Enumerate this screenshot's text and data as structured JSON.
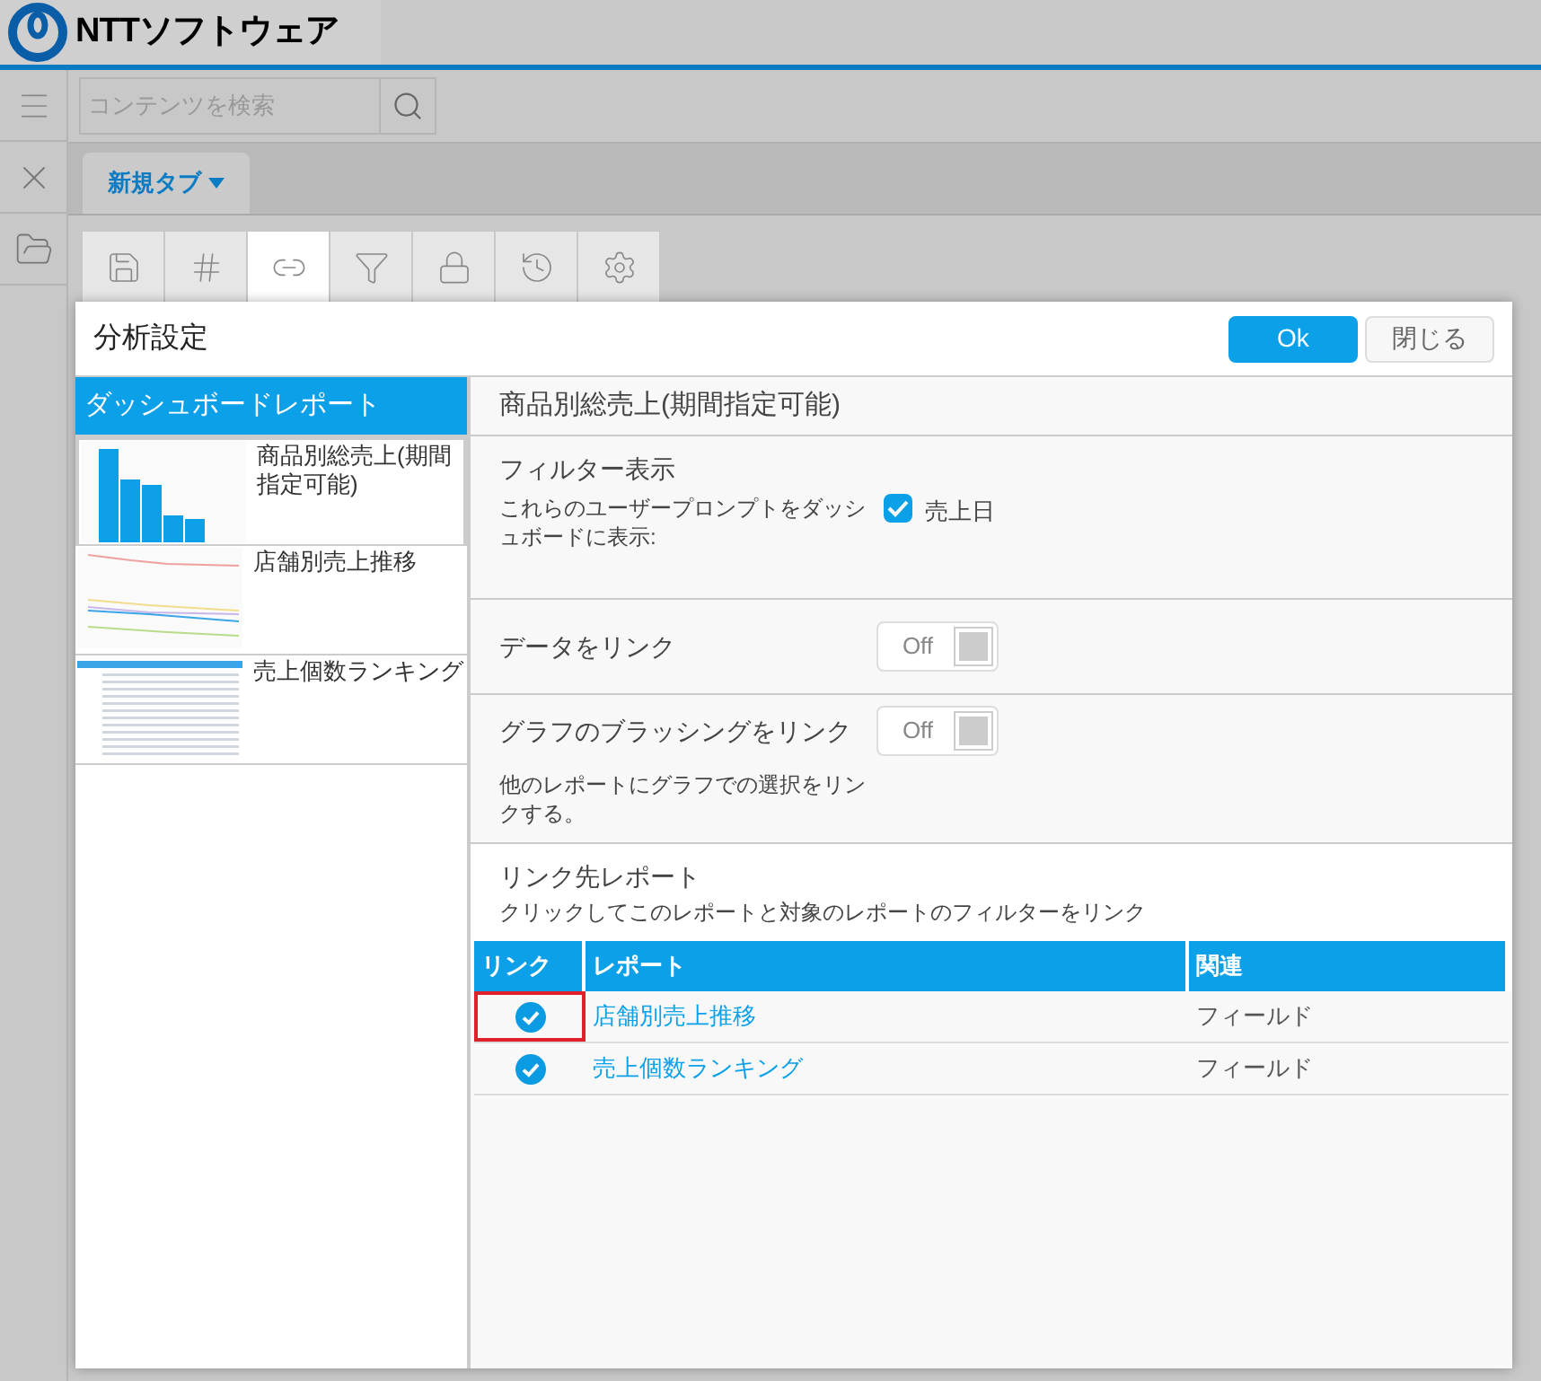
{
  "header": {
    "logo": "NTTソフトウェア"
  },
  "search": {
    "placeholder": "コンテンツを検索"
  },
  "tabs": [
    {
      "label": "新規タブ",
      "selected": true
    }
  ],
  "tools": [
    {
      "kind": "save",
      "selected": false
    },
    {
      "kind": "grid",
      "selected": false
    },
    {
      "kind": "link",
      "selected": true
    },
    {
      "kind": "filter",
      "selected": false
    },
    {
      "kind": "lock",
      "selected": false
    },
    {
      "kind": "history",
      "selected": false
    },
    {
      "kind": "settings",
      "selected": false
    }
  ],
  "dialog": {
    "title": "分析設定",
    "buttons": [
      {
        "label": "Ok",
        "kind": "primary"
      },
      {
        "label": "閉じる",
        "kind": "secondary"
      }
    ],
    "sidebar": {
      "title": "ダッシュボードレポート",
      "items": [
        {
          "title": "商品別総売上(期間指定可能)",
          "kind": "bar",
          "selected": true
        },
        {
          "title": "店舗別売上推移",
          "kind": "line",
          "selected": false
        },
        {
          "title": "売上個数ランキング",
          "kind": "table",
          "selected": false
        }
      ]
    },
    "report_title": "商品別総売上(期間指定可能)",
    "filter": {
      "title": "フィルター表示",
      "description": "これらのユーザープロンプトをダッシュボードに表示:",
      "prompts": [
        {
          "label": "売上日",
          "checked": true
        }
      ]
    },
    "toggles": [
      {
        "label": "データをリンク",
        "on": false,
        "text": "Off"
      },
      {
        "label": "グラフのブラッシングをリンク",
        "on": false,
        "text": "Off",
        "note": "他のレポートにグラフでの選択をリンクする。"
      }
    ],
    "linked": {
      "title": "リンク先レポート",
      "hint": "クリックしてこのレポートと対象のレポートのフィルターをリンク",
      "columns": [
        "リンク",
        "レポート",
        "関連"
      ],
      "rows": [
        {
          "linked": true,
          "highlighted": true,
          "report": "店舗別売上推移",
          "relation": "フィールド"
        },
        {
          "linked": true,
          "highlighted": false,
          "report": "売上個数ランキング",
          "relation": "フィールド"
        }
      ]
    }
  }
}
